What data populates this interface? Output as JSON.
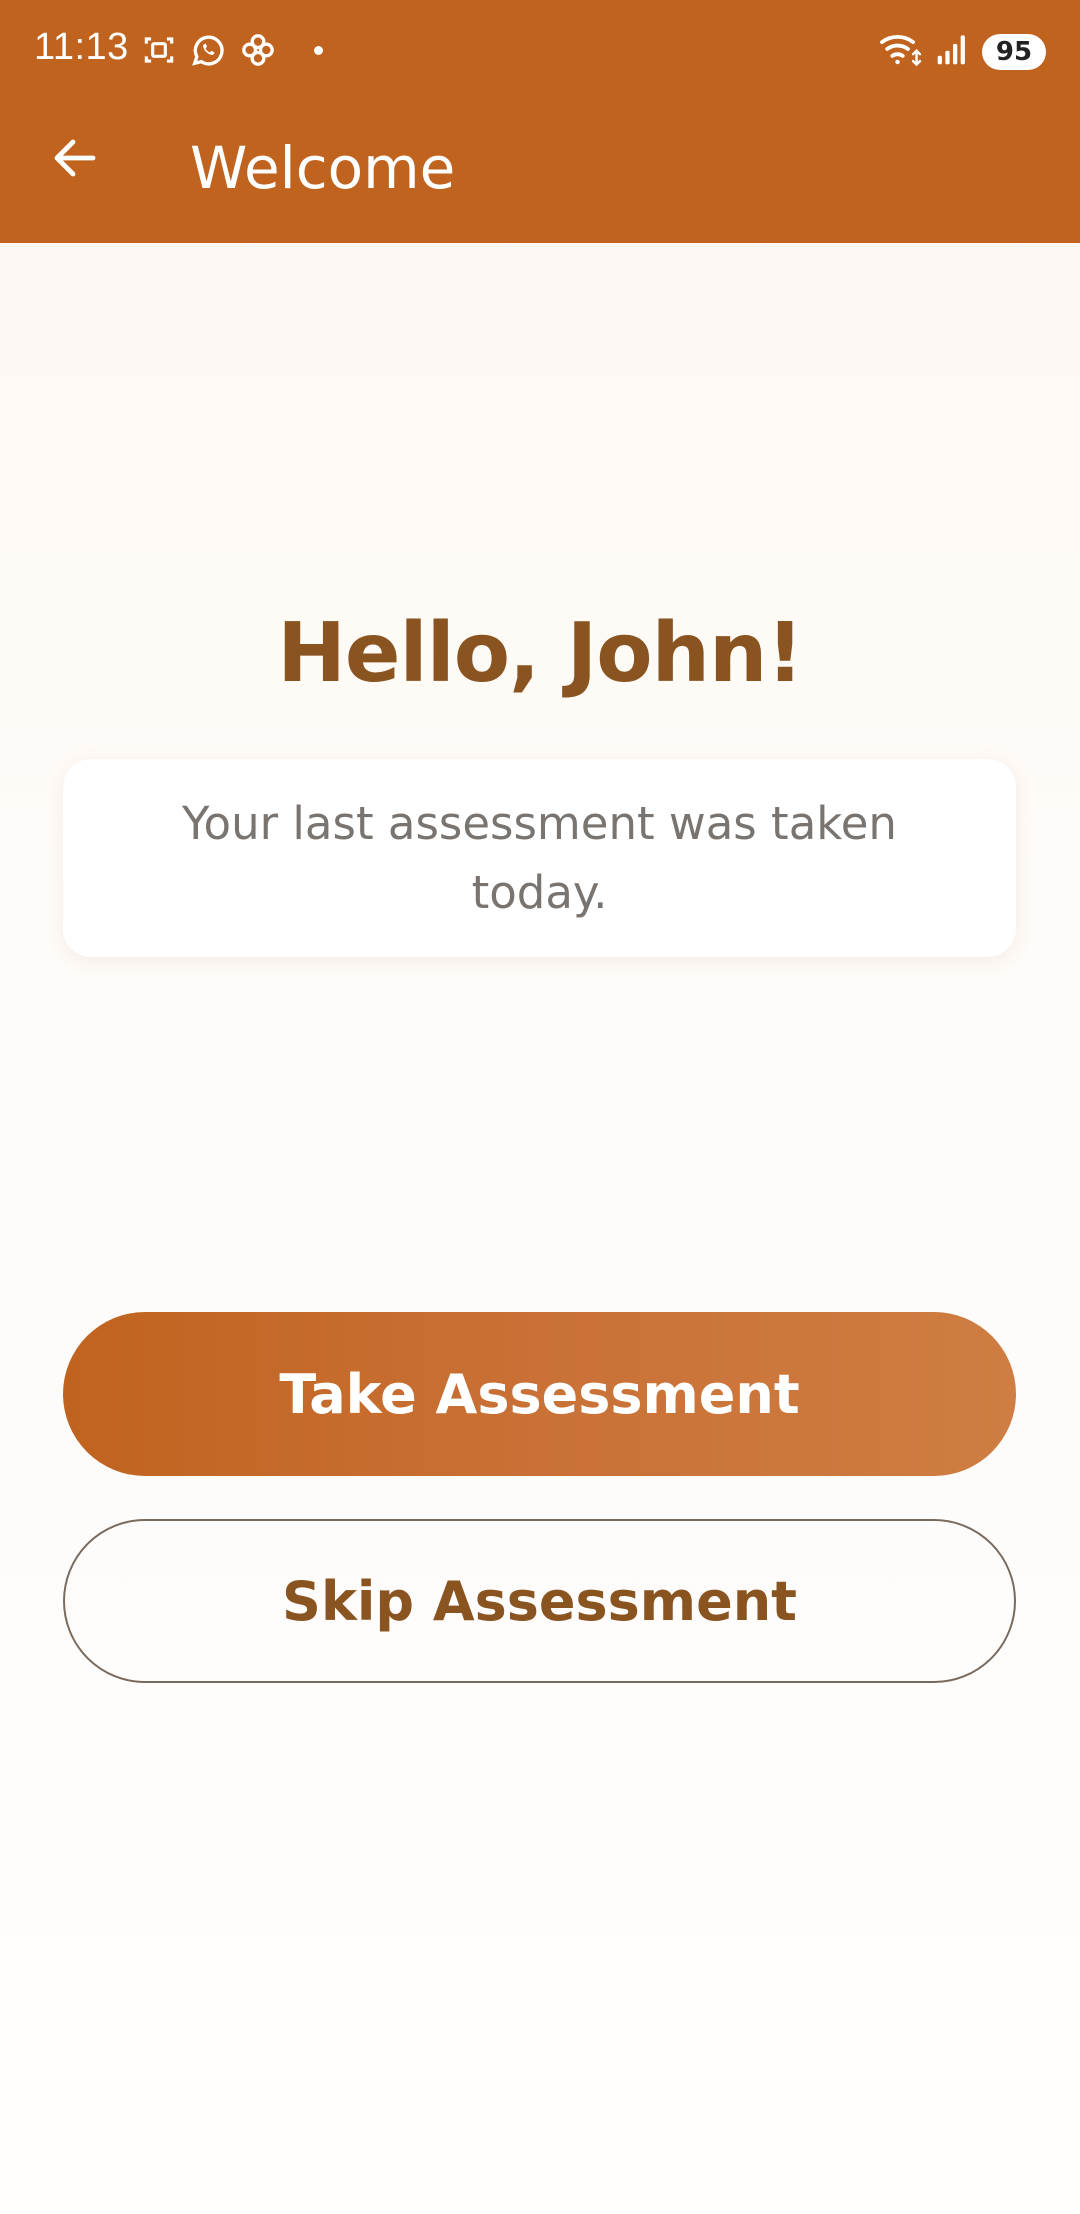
{
  "status_bar": {
    "time": "11:13",
    "battery": "95",
    "icons_left": [
      "screenshot-icon",
      "whatsapp-icon",
      "flower-app-icon",
      "notification-dot"
    ],
    "icons_right": [
      "wifi-icon",
      "signal-icon",
      "battery-icon"
    ]
  },
  "app_bar": {
    "title": "Welcome",
    "back_icon": "arrow-left-icon",
    "color": "#c0631f"
  },
  "main": {
    "greeting": "Hello, John!",
    "info_text": "Your last assessment was taken today."
  },
  "actions": {
    "primary_label": "Take Assessment",
    "secondary_label": "Skip Assessment"
  },
  "colors": {
    "accent": "#c0631f",
    "heading": "#8a5420",
    "muted_text": "#7a7470",
    "background": "#fdf7f1"
  }
}
